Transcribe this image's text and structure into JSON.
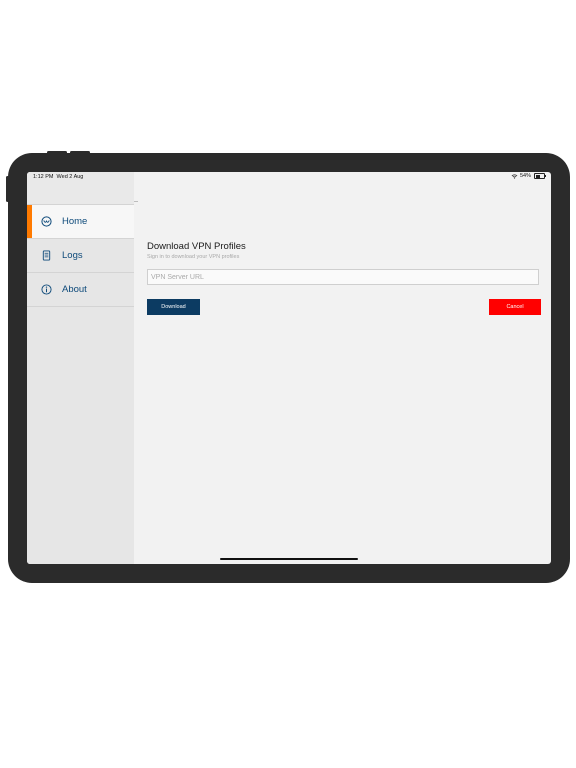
{
  "status_bar": {
    "time": "1:12 PM",
    "date": "Wed 2 Aug",
    "battery": "54%"
  },
  "sidebar": {
    "items": [
      {
        "label": "Home",
        "icon": "home-logo-icon",
        "active": true
      },
      {
        "label": "Logs",
        "icon": "document-icon",
        "active": false
      },
      {
        "label": "About",
        "icon": "info-icon",
        "active": false
      }
    ]
  },
  "main": {
    "title": "Download VPN Profiles",
    "subtitle": "Sign in to download your VPN profiles",
    "url_input": {
      "value": "",
      "placeholder": "VPN Server URL"
    },
    "download_label": "Download",
    "cancel_label": "Cancel"
  },
  "colors": {
    "accent": "#ff7a00",
    "primary": "#0c3b62",
    "danger": "#ff0000",
    "nav_text": "#0e4a7a"
  }
}
